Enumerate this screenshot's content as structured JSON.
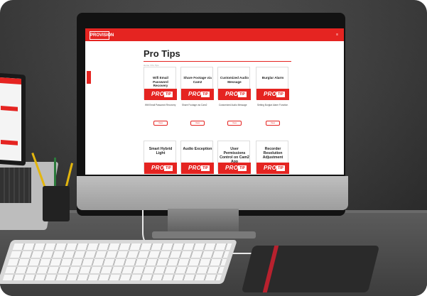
{
  "site": {
    "logo": "PROVISION",
    "header_text": "",
    "nav": "≡"
  },
  "page": {
    "title": "Pro Tips",
    "breadcrumb": "Home / Pro Tips"
  },
  "cards_row1": [
    {
      "title": "Wifi Email Password Recovery",
      "sub": "Wifi Email Password Recovery",
      "button": "View"
    },
    {
      "title": "Share Footage via Cam2",
      "sub": "Share Footage via Cam2",
      "button": "View"
    },
    {
      "title": "Customized Audio Message",
      "sub": "Customized Audio Message",
      "button": "View"
    },
    {
      "title": "Burglar Alarm",
      "sub": "Setting Burglar Alarm Function",
      "button": "View"
    }
  ],
  "cards_row2": [
    {
      "title": "Smart Hybrid Light"
    },
    {
      "title": "Audio Exception"
    },
    {
      "title": "User Permissions Control on Cam2 App"
    },
    {
      "title": "Recorder Resolution Adjustment"
    }
  ],
  "pro_tip_badge": {
    "pro": "PRO",
    "tip": "TIP"
  },
  "colors": {
    "brand": "#e52421",
    "wall": "#3a3a3a",
    "desk": "#4d4d4d"
  }
}
